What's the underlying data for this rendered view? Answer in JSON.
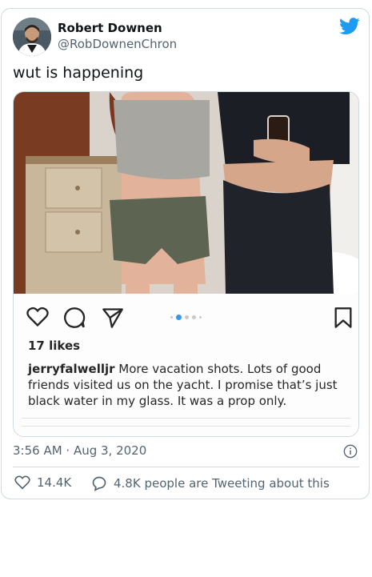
{
  "author": {
    "name": "Robert Downen",
    "handle": "@RobDownenChron"
  },
  "tweet": {
    "text": "wut is happening",
    "timestamp": "3:56 AM · Aug 3, 2020"
  },
  "media": {
    "likes": "17 likes",
    "caption_user": "jerryfalwelljr",
    "caption_text": " More vacation shots.  Lots of good friends visited us on the yacht.  I promise that’s just black water in my glass.  It was a prop only."
  },
  "actions": {
    "like_count": "14.4K",
    "conversation_text": "4.8K people are Tweeting about this"
  },
  "icons": {
    "brand": "twitter-bird-icon",
    "info": "info-icon",
    "heart": "heart-icon",
    "reply": "speech-bubble-icon"
  },
  "colors": {
    "twitter_blue": "#1d9bf0",
    "muted_text": "#536471",
    "border": "#cfd9de",
    "ig_dot_active": "#3897f0"
  }
}
